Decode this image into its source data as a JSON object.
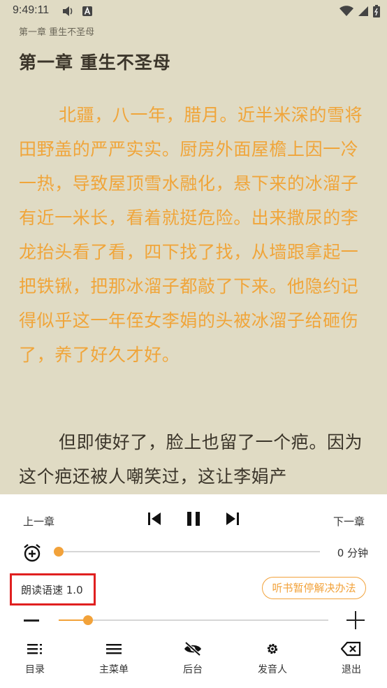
{
  "status_bar": {
    "time": "9:49:11",
    "icons": [
      "cast-icon",
      "a-badge-icon",
      "wifi-icon",
      "signal-icon",
      "battery-icon"
    ]
  },
  "reader": {
    "header_chapter": "第一章 重生不圣母",
    "chapter_title": "第一章 重生不圣母",
    "paragraphs": [
      "北疆，八一年，腊月。近半米深的雪将田野盖的严严实实。厨房外面屋檐上因一冷一热，导致屋顶雪水融化，悬下来的冰溜子有近一米长，看着就挺危险。出来撒尿的李龙抬头看了看，四下找了找，从墙跟拿起一把铁锹，把那冰溜子都敲了下来。他隐约记得似乎这一年侄女李娟的头被冰溜子给砸伤了，养了好久才好。",
      "但即使好了，脸上也留了一个疤。因为这个疤还被人嘲笑过，这让李娟产"
    ],
    "highlight_color": "#f0a53a",
    "background_color": "#e0dbc4"
  },
  "panel": {
    "prev_chapter": "上一章",
    "next_chapter": "下一章",
    "controls": [
      "skip-previous-icon",
      "pause-icon",
      "skip-next-icon"
    ],
    "timer": {
      "icon": "alarm-add-icon",
      "value_label": "0 分钟",
      "level": 0
    },
    "speed": {
      "label": "朗读语速 1.0",
      "level": 0.11
    },
    "help_button": "听书暂停解决办法",
    "accent_color": "#f2a23a"
  },
  "tabs": [
    {
      "icon": "toc-icon",
      "label": "目录"
    },
    {
      "icon": "menu-icon",
      "label": "主菜单"
    },
    {
      "icon": "eye-off-icon",
      "label": "后台"
    },
    {
      "icon": "gear-icon",
      "label": "发音人"
    },
    {
      "icon": "backspace-icon",
      "label": "退出"
    }
  ]
}
